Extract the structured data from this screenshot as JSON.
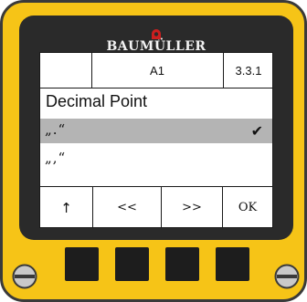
{
  "device": {
    "brand": "BAUMÜLLER",
    "brand_logo_color": "#cc1f1f",
    "housing_color": "#f6c417"
  },
  "screen": {
    "header": {
      "left": "",
      "center": "A1",
      "right": "3.3.1"
    },
    "title": "Decimal Point",
    "options": [
      {
        "label": "„.“",
        "selected": true,
        "check": "✔"
      },
      {
        "label": "„,“",
        "selected": false
      }
    ],
    "softkeys": [
      {
        "label": "↑",
        "icon": "up-arrow-icon"
      },
      {
        "label": "<<"
      },
      {
        "label": ">>"
      },
      {
        "label": "OK"
      }
    ]
  },
  "hardware_buttons": [
    {
      "name": "hardware-key-1"
    },
    {
      "name": "hardware-key-2"
    },
    {
      "name": "hardware-key-3"
    },
    {
      "name": "hardware-key-4"
    }
  ]
}
